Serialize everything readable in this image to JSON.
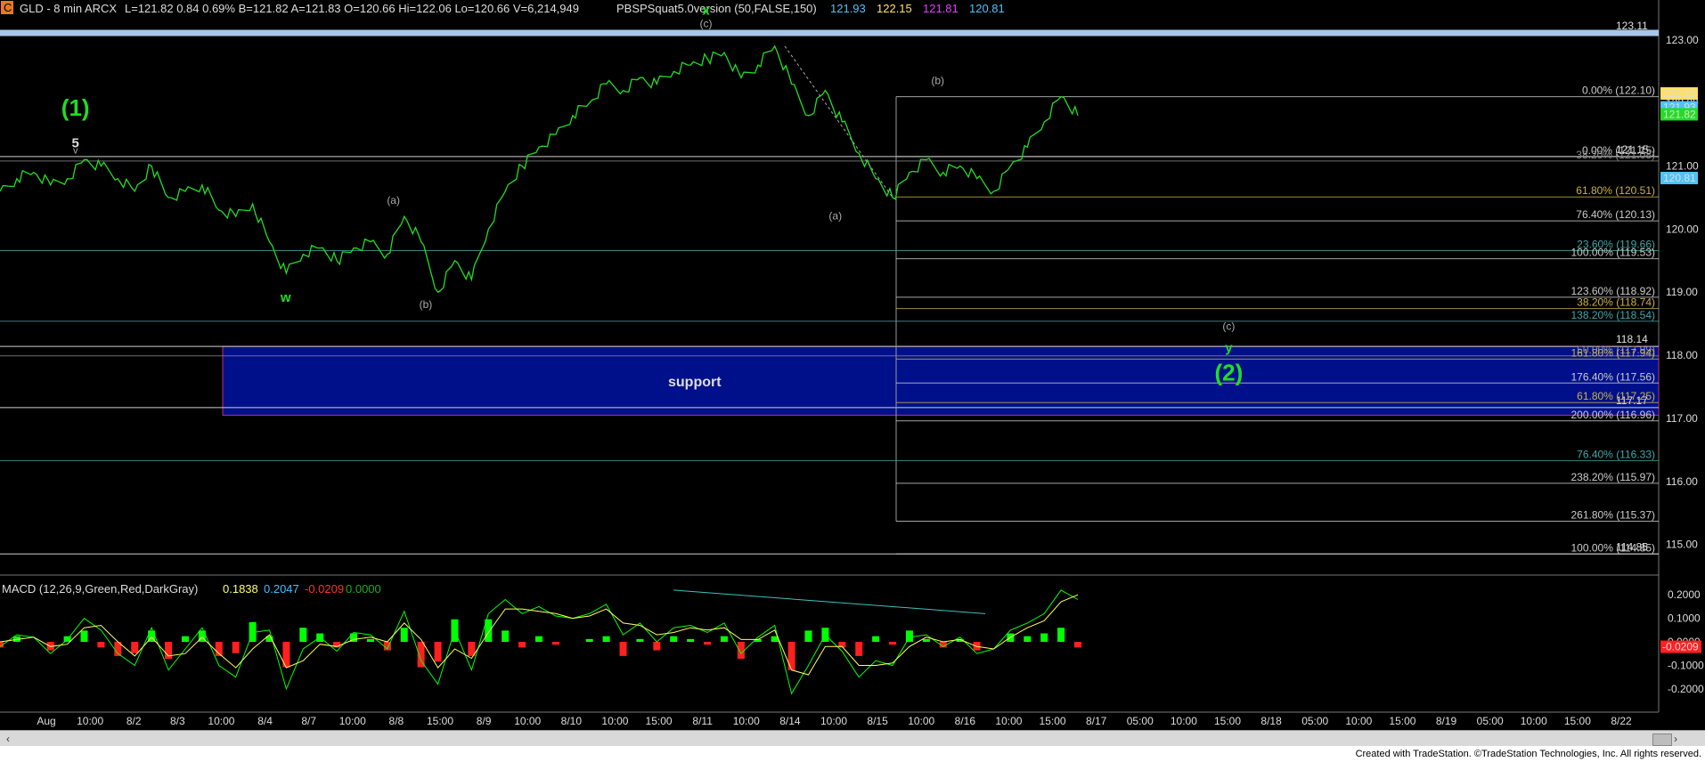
{
  "header": {
    "badge": "C",
    "title": "GLD - 8 min  ARCX",
    "quote": "L=121.82  0.84  0.69%  B=121.82  A=121.83  O=120.66  Hi=122.06  Lo=120.66  V=6,214,949",
    "indicator": "PBSPSquat5.0version (50,FALSE,150)",
    "ind_values": [
      {
        "text": "121.93",
        "color": "#4fc3f7"
      },
      {
        "text": "122.15",
        "color": "#ffe066"
      },
      {
        "text": "121.81",
        "color": "#e040fb"
      },
      {
        "text": "120.81",
        "color": "#4fc3f7"
      }
    ]
  },
  "colors": {
    "price": "#22dd22",
    "support_fill": "#00108a",
    "support_border": "#c03070",
    "label_green": "#22dd22",
    "label_gray": "#aaaaaa",
    "macd": "#00ff00",
    "signal": "#ffff66",
    "hist_pos": "#00ff00",
    "hist_neg": "#ff2020",
    "divergence_line": "#40c0c0"
  },
  "chart_data": [
    {
      "type": "line",
      "title": "GLD - 8 min",
      "y_axis_labels": [
        "123.00",
        "122.00",
        "121.00",
        "120.00",
        "119.00",
        "118.00",
        "117.00",
        "116.00",
        "115.00"
      ],
      "ylim": [
        114.6,
        123.35
      ],
      "x_axis_labels": [
        "Aug",
        "10:00",
        "8/2",
        "8/3",
        "10:00",
        "8/4",
        "8/7",
        "10:00",
        "8/8",
        "15:00",
        "8/9",
        "10:00",
        "8/10",
        "10:00",
        "15:00",
        "8/11",
        "10:00",
        "8/14",
        "10:00",
        "8/15",
        "10:00",
        "8/16",
        "10:00",
        "15:00",
        "8/17",
        "05:00",
        "10:00",
        "15:00",
        "8/18",
        "05:00",
        "10:00",
        "15:00",
        "8/19",
        "05:00",
        "10:00",
        "15:00",
        "8/22"
      ],
      "price_path": {
        "x": [
          0,
          0.01,
          0.02,
          0.03,
          0.04,
          0.05,
          0.06,
          0.07,
          0.08,
          0.09,
          0.1,
          0.11,
          0.12,
          0.13,
          0.14,
          0.15,
          0.16,
          0.17,
          0.18,
          0.19,
          0.2,
          0.21,
          0.22,
          0.23,
          0.24,
          0.25,
          0.26,
          0.27,
          0.28,
          0.29,
          0.3,
          0.31,
          0.32,
          0.33,
          0.34,
          0.35,
          0.36,
          0.37,
          0.38,
          0.39,
          0.4,
          0.41,
          0.42,
          0.43,
          0.44,
          0.45,
          0.46,
          0.47,
          0.48,
          0.49,
          0.5,
          0.51,
          0.52,
          0.53,
          0.54,
          0.55,
          0.56,
          0.57,
          0.58,
          0.59,
          0.6,
          0.61,
          0.62,
          0.63,
          0.64
        ],
        "y": [
          120.6,
          120.8,
          120.9,
          120.7,
          120.8,
          121.1,
          121.0,
          120.8,
          120.6,
          121.0,
          120.5,
          120.6,
          120.7,
          120.3,
          120.2,
          120.4,
          119.8,
          119.3,
          119.6,
          119.7,
          119.5,
          119.7,
          119.8,
          119.6,
          120.2,
          119.8,
          119.0,
          119.5,
          119.2,
          120.0,
          120.6,
          121.0,
          121.3,
          121.5,
          121.8,
          122.0,
          122.3,
          122.2,
          122.4,
          122.3,
          122.5,
          122.6,
          122.7,
          122.8,
          122.4,
          122.6,
          122.9,
          122.3,
          121.8,
          122.2,
          121.7,
          121.2,
          120.8,
          120.5,
          120.9,
          121.1,
          120.9,
          121.0,
          120.8,
          120.6,
          121.0,
          121.3,
          121.7,
          122.1,
          121.8
        ]
      },
      "price_levels": [
        {
          "label": "123.11",
          "value": 123.11
        },
        {
          "label": "121.15",
          "value": 121.15
        },
        {
          "label": "118.14",
          "value": 118.14
        },
        {
          "label": "117.17",
          "value": 117.17
        },
        {
          "label": "114.85",
          "value": 114.85
        }
      ],
      "price_flags": [
        {
          "label": "122.15",
          "value": 122.15,
          "bg": "#ffe066",
          "fg": "#000"
        },
        {
          "label": "121.93",
          "value": 121.93,
          "bg": "#4fc3f7",
          "fg": "#000"
        },
        {
          "label": "121.82",
          "value": 121.82,
          "bg": "#22dd22",
          "fg": "#000"
        },
        {
          "label": "120.81",
          "value": 120.81,
          "bg": "#4fc3f7",
          "fg": "#000"
        }
      ],
      "fib_levels": [
        {
          "label": "0.00% (122.10)",
          "value": 122.1,
          "color": "#cccccc"
        },
        {
          "label": "0.00% (121.15)",
          "value": 121.15,
          "color": "#cccccc"
        },
        {
          "label": "38.20% (121.08)",
          "value": 121.08,
          "color": "#8a8a8a"
        },
        {
          "label": "61.80% (120.51)",
          "value": 120.51,
          "color": "#c9b24a"
        },
        {
          "label": "76.40% (120.13)",
          "value": 120.13,
          "color": "#cccccc"
        },
        {
          "label": "23.60% (119.66)",
          "value": 119.66,
          "color": "#3fa7a7"
        },
        {
          "label": "100.00% (119.53)",
          "value": 119.53,
          "color": "#cccccc"
        },
        {
          "label": "123.60% (118.92)",
          "value": 118.92,
          "color": "#cccccc"
        },
        {
          "label": "38.20% (118.74)",
          "value": 118.74,
          "color": "#c9b24a"
        },
        {
          "label": "138.20% (118.54)",
          "value": 118.54,
          "color": "#3fa7a7"
        },
        {
          "label": "50.00% (117.99)",
          "value": 117.99,
          "color": "#8a8a8a"
        },
        {
          "label": "161.80% (117.94)",
          "value": 117.94,
          "color": "#c9b24a"
        },
        {
          "label": "176.40% (117.56)",
          "value": 117.56,
          "color": "#cccccc"
        },
        {
          "label": "61.80% (117.25)",
          "value": 117.25,
          "color": "#c9b24a"
        },
        {
          "label": "200.00% (116.96)",
          "value": 116.96,
          "color": "#cccccc"
        },
        {
          "label": "76.40% (116.33)",
          "value": 116.33,
          "color": "#3fa7a7"
        },
        {
          "label": "238.20% (115.97)",
          "value": 115.97,
          "color": "#cccccc"
        },
        {
          "label": "261.80% (115.37)",
          "value": 115.37,
          "color": "#cccccc"
        },
        {
          "label": "100.00% (114.85)",
          "value": 114.85,
          "color": "#cccccc"
        }
      ],
      "support_zone": {
        "label": "support",
        "top": 118.14,
        "bottom": 117.05
      },
      "wave_labels": [
        {
          "text": "(1)",
          "style": "big_green",
          "x": 0.07,
          "y": 121.8
        },
        {
          "text": "5",
          "style": "white",
          "x": 0.07,
          "y": 121.3
        },
        {
          "text": "v",
          "style": "gray_small",
          "x": 0.07,
          "y": 121.2
        },
        {
          "text": "w",
          "style": "green",
          "x": 0.265,
          "y": 118.85
        },
        {
          "text": "(a)",
          "style": "gray",
          "x": 0.365,
          "y": 120.4
        },
        {
          "text": "(b)",
          "style": "gray",
          "x": 0.395,
          "y": 118.75
        },
        {
          "text": "x",
          "style": "green",
          "x": 0.655,
          "y": 123.4
        },
        {
          "text": "(c)",
          "style": "gray",
          "x": 0.655,
          "y": 123.2
        },
        {
          "text": "(a)",
          "style": "gray",
          "x": 0.775,
          "y": 120.15
        },
        {
          "text": "(b)",
          "style": "gray",
          "x": 0.87,
          "y": 122.3
        },
        {
          "text": "(c)",
          "style": "gray",
          "x": 1.14,
          "y": 118.4
        },
        {
          "text": "y",
          "style": "green",
          "x": 1.14,
          "y": 118.05
        },
        {
          "text": "(2)",
          "style": "big_green",
          "x": 1.14,
          "y": 117.6
        }
      ]
    },
    {
      "type": "line",
      "title": "MACD",
      "legend_label": "MACD (12,26,9,Green,Red,DarkGray)",
      "legend_values": [
        {
          "text": "0.1838",
          "color": "#ffff66"
        },
        {
          "text": "0.2047",
          "color": "#40c0ff"
        },
        {
          "text": "-0.0209",
          "color": "#ff3030"
        },
        {
          "text": "0.0000",
          "color": "#22aa22"
        }
      ],
      "y_axis_labels": [
        "0.2000",
        "0.1000",
        "0.0000",
        "-0.1000",
        "-0.2000"
      ],
      "ylim": [
        -0.28,
        0.25
      ],
      "current_flag": {
        "label": "-0.0209",
        "value": -0.0209
      },
      "macd": [
        -0.02,
        0.03,
        0.02,
        -0.05,
        0.01,
        0.1,
        0.05,
        -0.05,
        -0.1,
        0.06,
        -0.12,
        -0.03,
        0.06,
        -0.1,
        -0.15,
        0.04,
        0.05,
        -0.2,
        -0.03,
        0.02,
        -0.04,
        0.04,
        0.03,
        -0.03,
        0.13,
        -0.08,
        -0.18,
        0.05,
        -0.12,
        0.12,
        0.18,
        0.12,
        0.15,
        0.11,
        0.1,
        0.12,
        0.16,
        0.03,
        0.08,
        0.0,
        0.06,
        0.07,
        0.04,
        0.08,
        -0.05,
        0.02,
        0.07,
        -0.22,
        -0.1,
        0.03,
        -0.04,
        -0.15,
        -0.08,
        -0.1,
        0.02,
        0.03,
        -0.02,
        0.02,
        -0.05,
        -0.03,
        0.05,
        0.08,
        0.12,
        0.22,
        0.18
      ],
      "signal": [
        0.0,
        0.01,
        0.02,
        -0.02,
        -0.01,
        0.06,
        0.07,
        0.0,
        -0.06,
        0.02,
        -0.06,
        -0.05,
        0.02,
        -0.05,
        -0.11,
        -0.03,
        0.03,
        -0.11,
        -0.08,
        -0.01,
        -0.02,
        0.01,
        0.02,
        0.0,
        0.08,
        0.01,
        -0.11,
        -0.03,
        -0.07,
        0.04,
        0.14,
        0.14,
        0.13,
        0.12,
        0.1,
        0.11,
        0.14,
        0.08,
        0.07,
        0.03,
        0.04,
        0.06,
        0.05,
        0.06,
        0.01,
        0.01,
        0.05,
        -0.12,
        -0.14,
        -0.02,
        -0.02,
        -0.1,
        -0.1,
        -0.09,
        -0.02,
        0.02,
        0.0,
        0.01,
        -0.02,
        -0.03,
        0.02,
        0.06,
        0.09,
        0.17,
        0.2
      ]
    }
  ],
  "footer": {
    "text": "Created with TradeStation. ©TradeStation Technologies, Inc. All rights reserved."
  },
  "scroll": {
    "left_arrow": "‹",
    "right_arrow": "›"
  }
}
